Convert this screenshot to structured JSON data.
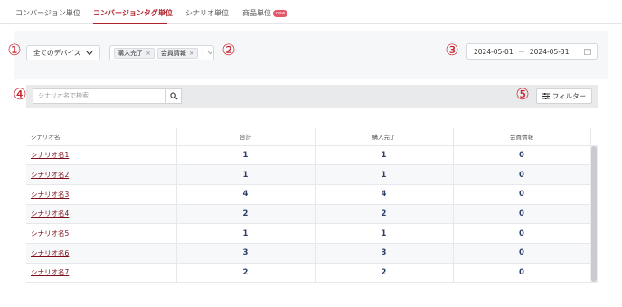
{
  "tabs": [
    {
      "label": "コンバージョン単位"
    },
    {
      "label": "コンバージョンタグ単位"
    },
    {
      "label": "シナリオ単位"
    },
    {
      "label": "商品単位",
      "badge": "new"
    }
  ],
  "markers": [
    "①",
    "②",
    "③",
    "④",
    "⑤"
  ],
  "filters": {
    "device": "全てのデバイス",
    "tags": [
      "購入完了",
      "会員情報"
    ],
    "date_from": "2024-05-01",
    "date_to": "2024-05-31",
    "date_arrow": "→"
  },
  "search": {
    "placeholder": "シナリオ名で検索"
  },
  "filter_button": "フィルター",
  "table": {
    "headers": [
      "シナリオ名",
      "合計",
      "購入完了",
      "会員情報"
    ],
    "rows": [
      {
        "name": "シナリオ名1",
        "total": "1",
        "purchase": "1",
        "member": "0"
      },
      {
        "name": "シナリオ名2",
        "total": "1",
        "purchase": "1",
        "member": "0"
      },
      {
        "name": "シナリオ名3",
        "total": "4",
        "purchase": "4",
        "member": "0"
      },
      {
        "name": "シナリオ名4",
        "total": "2",
        "purchase": "2",
        "member": "0"
      },
      {
        "name": "シナリオ名5",
        "total": "1",
        "purchase": "1",
        "member": "0"
      },
      {
        "name": "シナリオ名6",
        "total": "3",
        "purchase": "3",
        "member": "0"
      },
      {
        "name": "シナリオ名7",
        "total": "2",
        "purchase": "2",
        "member": "0"
      }
    ]
  },
  "colors": {
    "accent": "#b0202a",
    "marker": "#c8202c",
    "value": "#2d3f6b"
  }
}
